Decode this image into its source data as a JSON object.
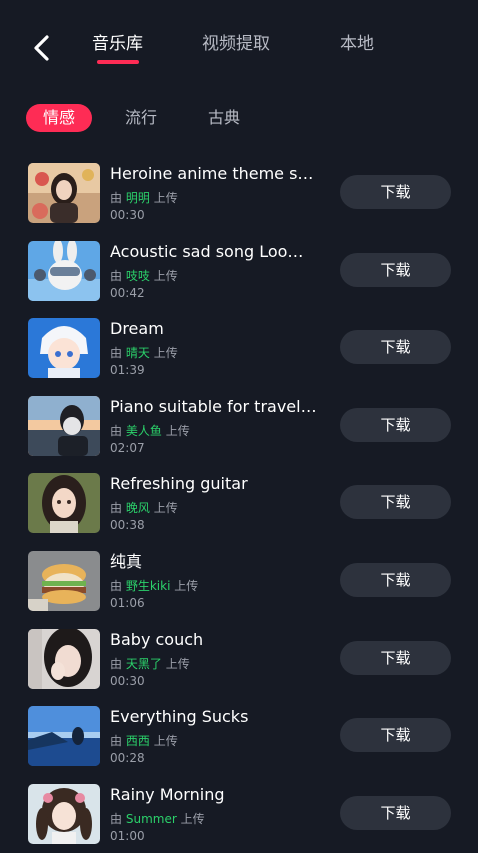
{
  "header": {
    "back_icon": "chevron-left-icon",
    "tabs": [
      {
        "label": "音乐库",
        "active": true
      },
      {
        "label": "视频提取",
        "active": false
      },
      {
        "label": "本地",
        "active": false
      }
    ]
  },
  "categories": [
    {
      "label": "情感",
      "active": true
    },
    {
      "label": "流行",
      "active": false
    },
    {
      "label": "古典",
      "active": false
    }
  ],
  "colors": {
    "background": "#161a24",
    "accent": "#fe2c55",
    "uploader": "#2bd06a",
    "button_bg": "#2d323d"
  },
  "songs": [
    {
      "title": "Heroine anime theme s…",
      "by": "由",
      "uploader": "明明",
      "suffix": "上传",
      "duration": "00:30",
      "download_label": "下载"
    },
    {
      "title": "Acoustic sad song Loo…",
      "by": "由",
      "uploader": "吱吱",
      "suffix": "上传",
      "duration": "00:42",
      "download_label": "下载"
    },
    {
      "title": "Dream",
      "by": "由",
      "uploader": "晴天",
      "suffix": "上传",
      "duration": "01:39",
      "download_label": "下载"
    },
    {
      "title": "Piano suitable for travel…",
      "by": "由",
      "uploader": "美人鱼",
      "suffix": "上传",
      "duration": "02:07",
      "download_label": "下载"
    },
    {
      "title": "Refreshing guitar",
      "by": "由",
      "uploader": "晚风",
      "suffix": "上传",
      "duration": "00:38",
      "download_label": "下载"
    },
    {
      "title": "纯真",
      "by": "由",
      "uploader": "野生kiki",
      "suffix": "上传",
      "duration": "01:06",
      "download_label": "下载"
    },
    {
      "title": "Baby couch",
      "by": "由",
      "uploader": "天黑了",
      "suffix": "上传",
      "duration": "00:30",
      "download_label": "下载"
    },
    {
      "title": "Everything Sucks",
      "by": "由",
      "uploader": "西西",
      "suffix": "上传",
      "duration": "00:28",
      "download_label": "下载"
    },
    {
      "title": "Rainy Morning",
      "by": "由",
      "uploader": "Summer",
      "suffix": "上传",
      "duration": "01:00",
      "download_label": "下载"
    }
  ]
}
